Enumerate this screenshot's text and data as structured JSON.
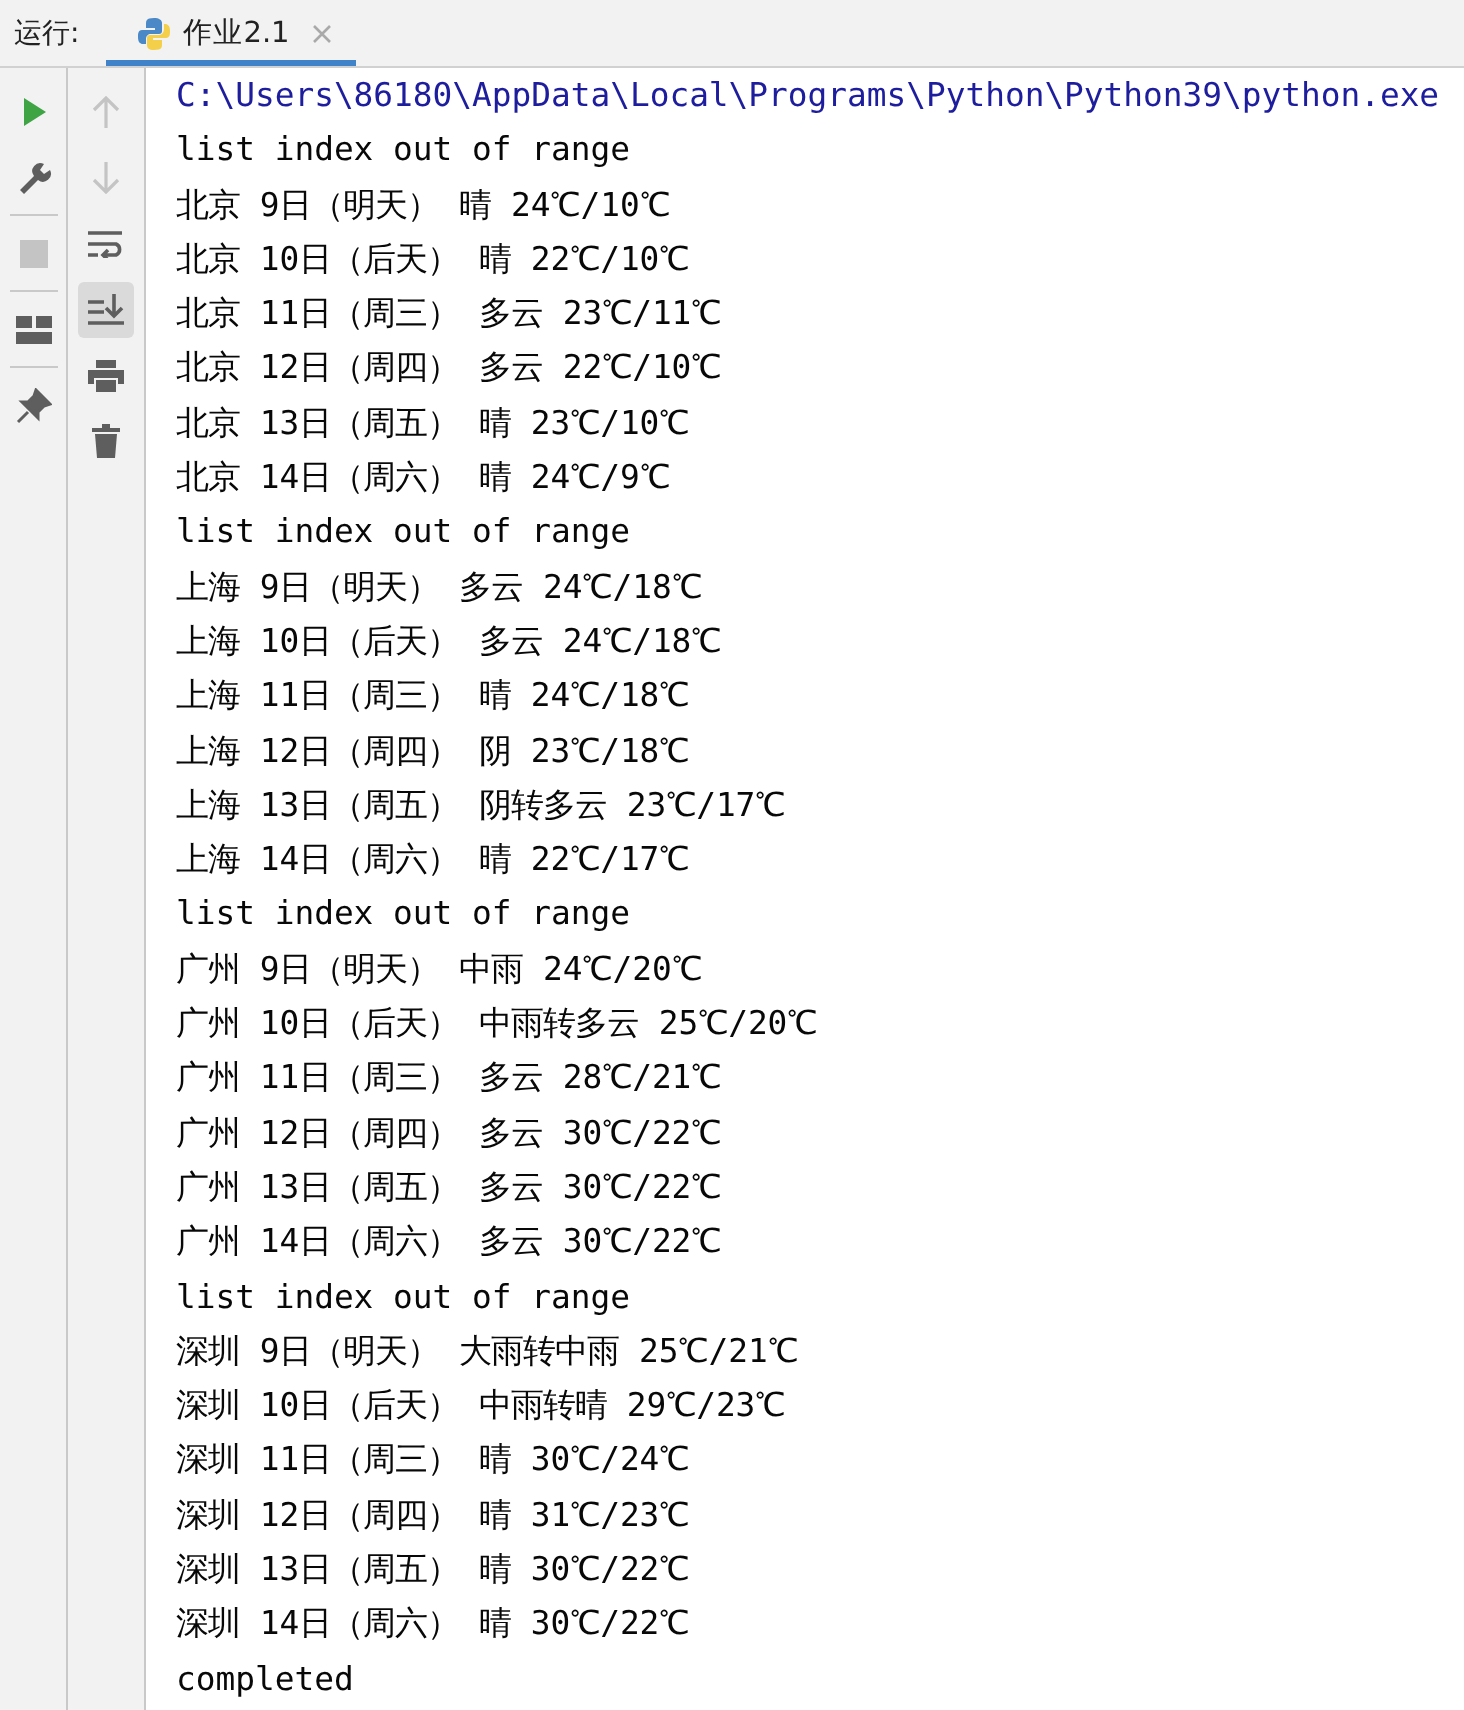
{
  "run_label": "运行:",
  "tab": {
    "label": "作业2.1",
    "selected": true
  },
  "left_tools": [
    {
      "disabled": false
    },
    {
      "disabled": false
    },
    {
      "disabled": true
    },
    {
      "disabled": false
    },
    {
      "disabled": false
    }
  ],
  "console_tools": [
    {
      "disabled": true,
      "selected": false
    },
    {
      "disabled": true,
      "selected": false
    },
    {
      "disabled": false,
      "selected": false
    },
    {
      "disabled": false,
      "selected": true
    },
    {
      "disabled": false,
      "selected": false
    },
    {
      "disabled": false,
      "selected": false
    }
  ],
  "output": [
    {
      "kind": "path",
      "text": "C:\\Users\\86180\\AppData\\Local\\Programs\\Python\\Python39\\python.exe"
    },
    {
      "kind": "text",
      "text": "list index out of range"
    },
    {
      "kind": "text",
      "text": "北京 9日（明天） 晴 24℃/10℃"
    },
    {
      "kind": "text",
      "text": "北京 10日（后天） 晴 22℃/10℃"
    },
    {
      "kind": "text",
      "text": "北京 11日（周三） 多云 23℃/11℃"
    },
    {
      "kind": "text",
      "text": "北京 12日（周四） 多云 22℃/10℃"
    },
    {
      "kind": "text",
      "text": "北京 13日（周五） 晴 23℃/10℃"
    },
    {
      "kind": "text",
      "text": "北京 14日（周六） 晴 24℃/9℃"
    },
    {
      "kind": "text",
      "text": "list index out of range"
    },
    {
      "kind": "text",
      "text": "上海 9日（明天） 多云 24℃/18℃"
    },
    {
      "kind": "text",
      "text": "上海 10日（后天） 多云 24℃/18℃"
    },
    {
      "kind": "text",
      "text": "上海 11日（周三） 晴 24℃/18℃"
    },
    {
      "kind": "text",
      "text": "上海 12日（周四） 阴 23℃/18℃"
    },
    {
      "kind": "text",
      "text": "上海 13日（周五） 阴转多云 23℃/17℃"
    },
    {
      "kind": "text",
      "text": "上海 14日（周六） 晴 22℃/17℃"
    },
    {
      "kind": "text",
      "text": "list index out of range"
    },
    {
      "kind": "text",
      "text": "广州 9日（明天） 中雨 24℃/20℃"
    },
    {
      "kind": "text",
      "text": "广州 10日（后天） 中雨转多云 25℃/20℃"
    },
    {
      "kind": "text",
      "text": "广州 11日（周三） 多云 28℃/21℃"
    },
    {
      "kind": "text",
      "text": "广州 12日（周四） 多云 30℃/22℃"
    },
    {
      "kind": "text",
      "text": "广州 13日（周五） 多云 30℃/22℃"
    },
    {
      "kind": "text",
      "text": "广州 14日（周六） 多云 30℃/22℃"
    },
    {
      "kind": "text",
      "text": "list index out of range"
    },
    {
      "kind": "text",
      "text": "深圳 9日（明天） 大雨转中雨 25℃/21℃"
    },
    {
      "kind": "text",
      "text": "深圳 10日（后天） 中雨转晴 29℃/23℃"
    },
    {
      "kind": "text",
      "text": "深圳 11日（周三） 晴 30℃/24℃"
    },
    {
      "kind": "text",
      "text": "深圳 12日（周四） 晴 31℃/23℃"
    },
    {
      "kind": "text",
      "text": "深圳 13日（周五） 晴 30℃/22℃"
    },
    {
      "kind": "text",
      "text": "深圳 14日（周六） 晴 30℃/22℃"
    },
    {
      "kind": "text",
      "text": "completed"
    }
  ]
}
